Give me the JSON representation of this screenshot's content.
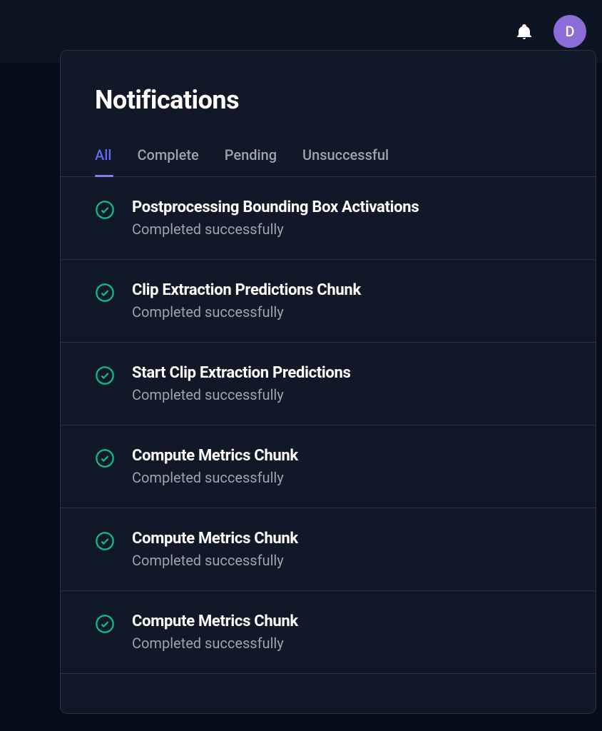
{
  "header": {
    "avatar_letter": "D"
  },
  "panel": {
    "title": "Notifications",
    "tabs": [
      {
        "label": "All",
        "active": true
      },
      {
        "label": "Complete",
        "active": false
      },
      {
        "label": "Pending",
        "active": false
      },
      {
        "label": "Unsuccessful",
        "active": false
      }
    ],
    "items": [
      {
        "title": "Postprocessing Bounding Box Activations",
        "subtitle": "Completed successfully",
        "status": "success"
      },
      {
        "title": "Clip Extraction Predictions Chunk",
        "subtitle": "Completed successfully",
        "status": "success"
      },
      {
        "title": "Start Clip Extraction Predictions",
        "subtitle": "Completed successfully",
        "status": "success"
      },
      {
        "title": "Compute Metrics Chunk",
        "subtitle": "Completed successfully",
        "status": "success"
      },
      {
        "title": "Compute Metrics Chunk",
        "subtitle": "Completed successfully",
        "status": "success"
      },
      {
        "title": "Compute Metrics Chunk",
        "subtitle": "Completed successfully",
        "status": "success"
      }
    ]
  },
  "colors": {
    "success": "#10b981",
    "accent": "#6366f1"
  }
}
